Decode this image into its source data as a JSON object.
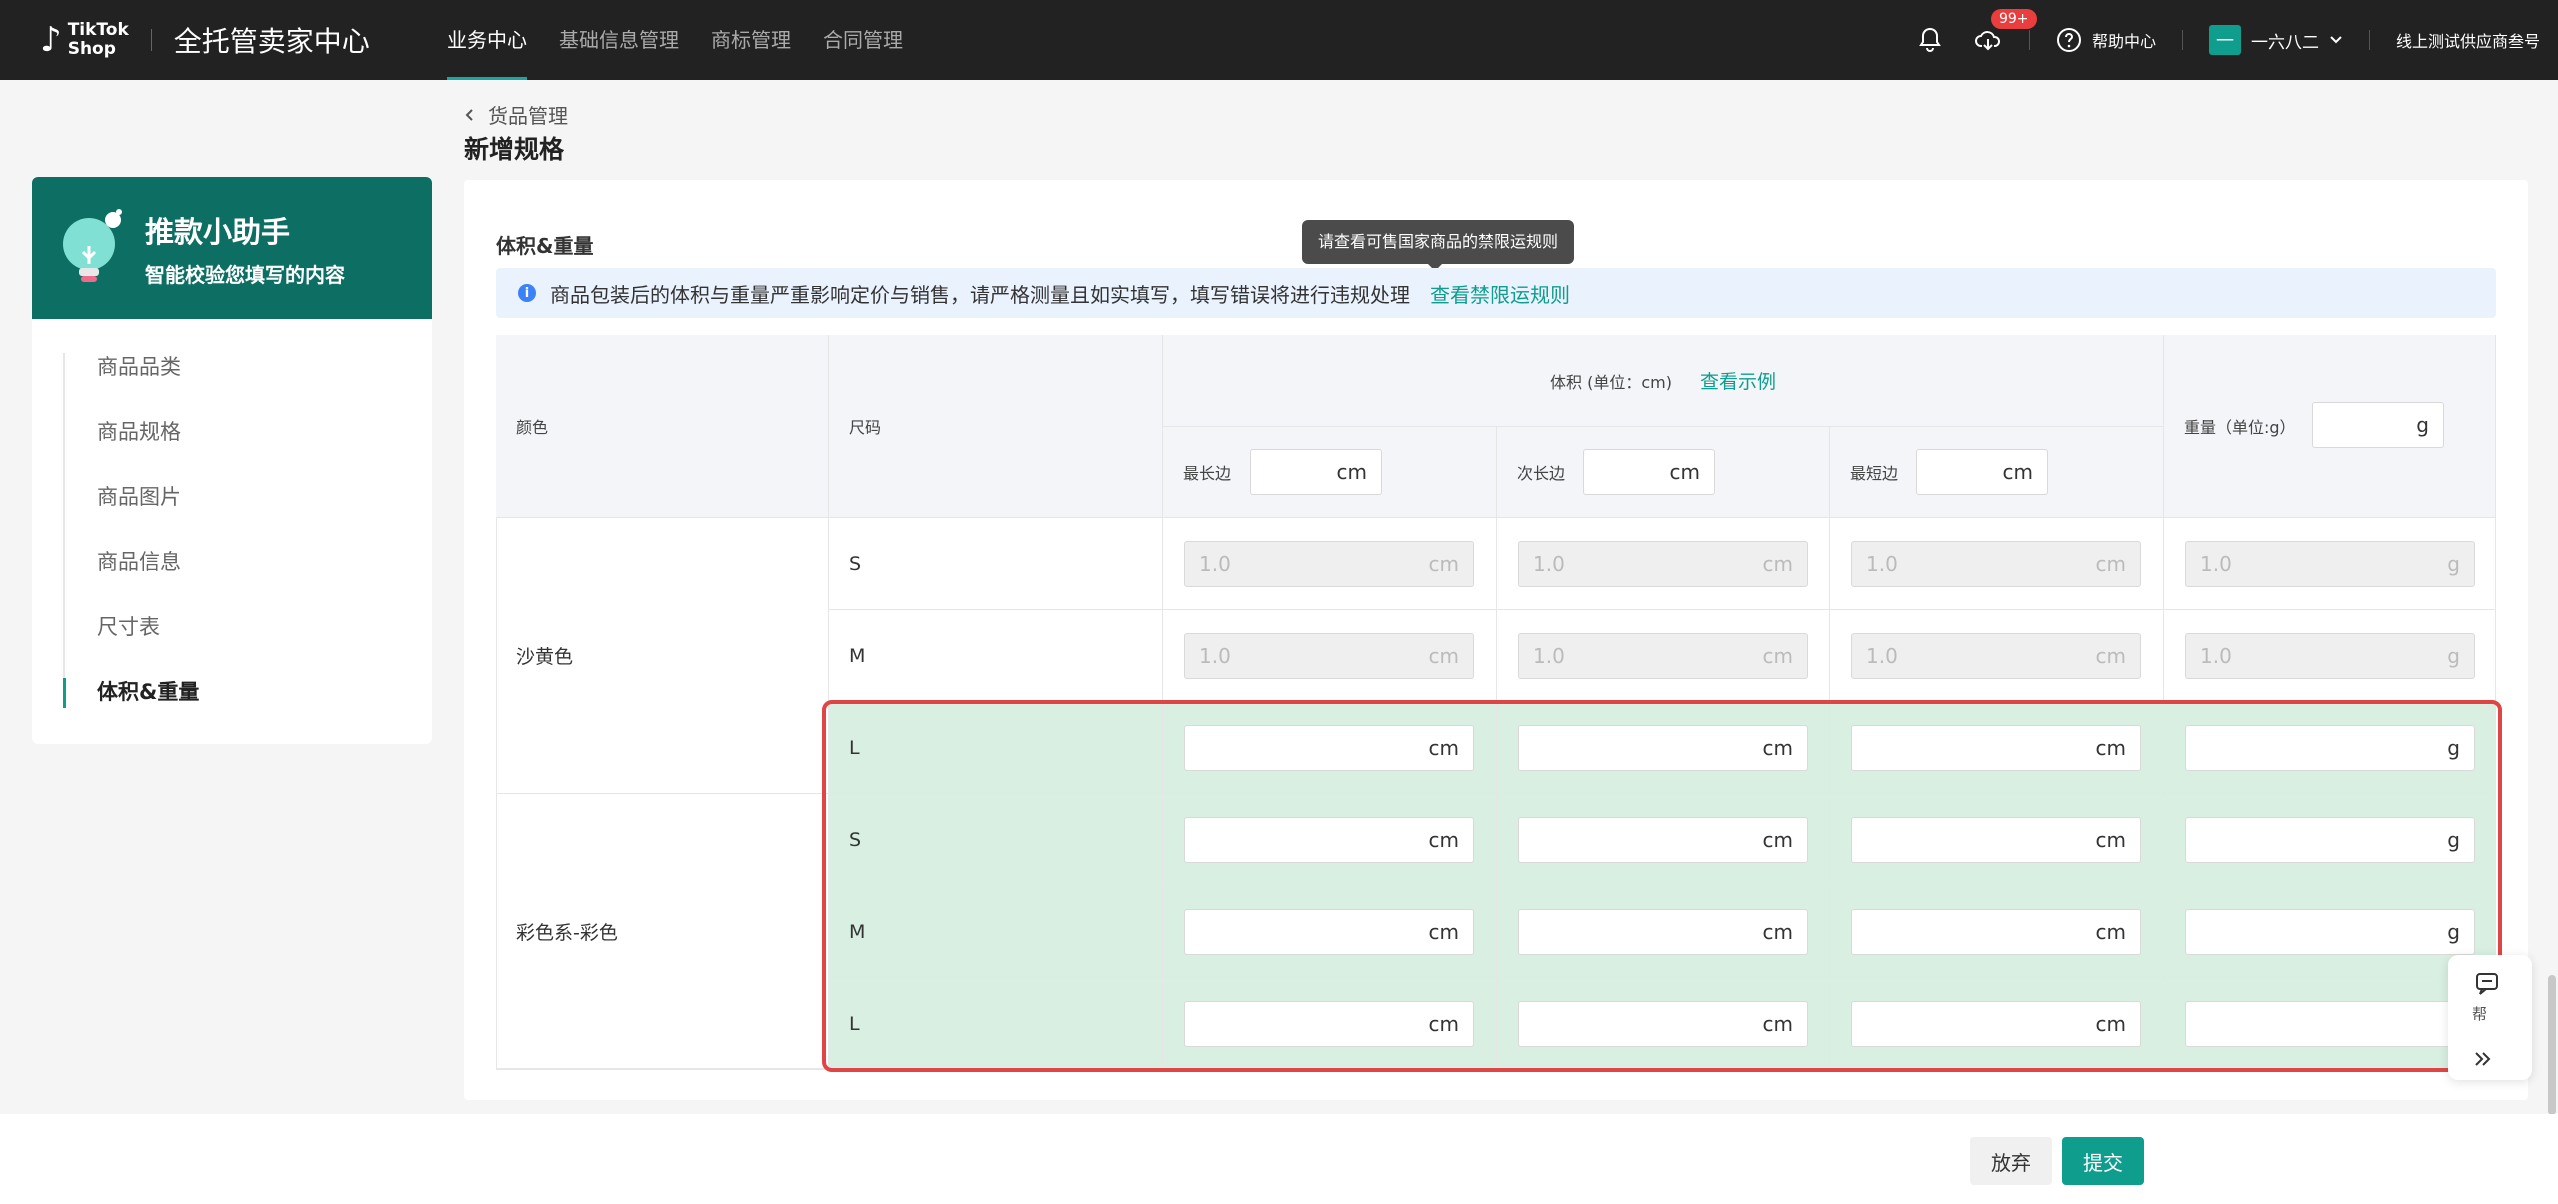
{
  "header": {
    "logo_line1": "TikTok",
    "logo_line2": "Shop",
    "title": "全托管卖家中心",
    "nav": [
      "业务中心",
      "基础信息管理",
      "商标管理",
      "合同管理"
    ],
    "badge": "99+",
    "help": "帮助中心",
    "avatar_char": "一",
    "user_name": "一六八二",
    "store": "线上测试供应商叁号"
  },
  "breadcrumb": "货品管理",
  "page_title": "新增规格",
  "sidebar": {
    "title": "推款小助手",
    "subtitle": "智能校验您填写的内容",
    "items": [
      "商品品类",
      "商品规格",
      "商品图片",
      "商品信息",
      "尺寸表",
      "体积&重量"
    ]
  },
  "section": {
    "title": "体积&重量",
    "notice": "商品包装后的体积与重量严重影响定价与销售，请严格测量且如实填写，填写错误将进行违规处理",
    "notice_link": "查看禁限运规则",
    "tooltip": "请查看可售国家商品的禁限运规则"
  },
  "table": {
    "col_color": "颜色",
    "col_size": "尺码",
    "volume_header": "体积 (单位：cm)",
    "volume_example": "查看示例",
    "weight_header": "重量（单位:g）",
    "longest": "最长边",
    "second": "次长边",
    "shortest": "最短边",
    "unit_cm": "cm",
    "unit_g": "g",
    "disabled_value": "1.0",
    "colors": [
      "沙黄色",
      "彩色系-彩色"
    ],
    "rows": [
      {
        "size": "S",
        "disabled": true
      },
      {
        "size": "M",
        "disabled": true
      },
      {
        "size": "L",
        "disabled": false
      },
      {
        "size": "S",
        "disabled": false
      },
      {
        "size": "M",
        "disabled": false
      },
      {
        "size": "L",
        "disabled": false
      }
    ]
  },
  "float_help": "帮",
  "buttons": {
    "cancel": "放弃",
    "submit": "提交"
  }
}
